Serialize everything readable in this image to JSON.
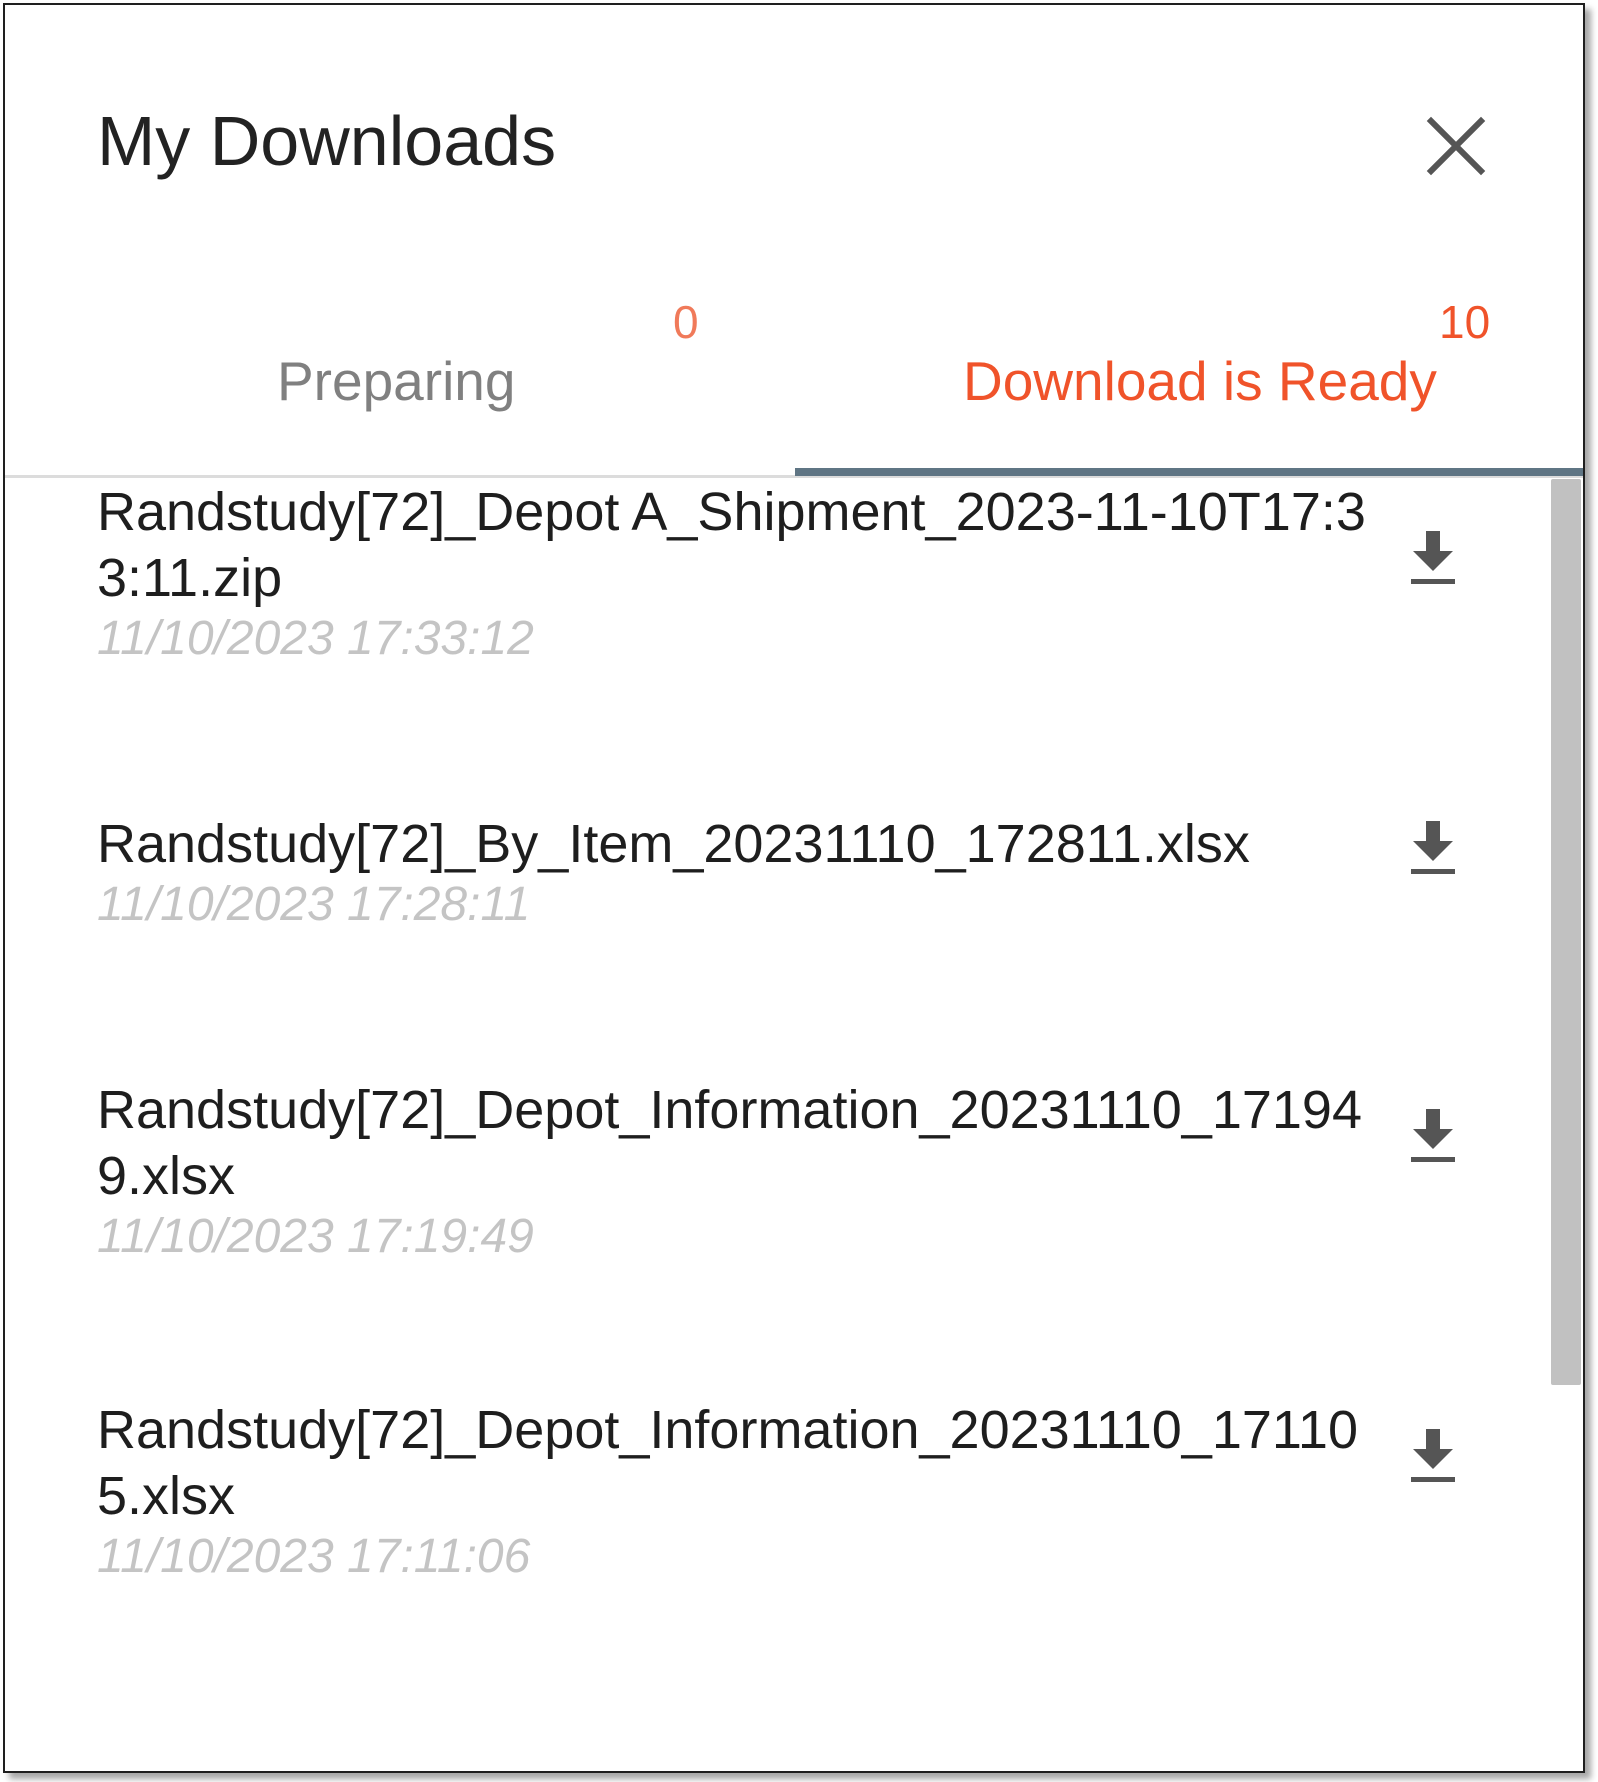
{
  "dialog": {
    "title": "My Downloads",
    "close_icon": "close-icon"
  },
  "tabs": [
    {
      "label": "Preparing",
      "count": "0",
      "active": false
    },
    {
      "label": "Download is Ready",
      "count": "10",
      "active": true
    }
  ],
  "colors": {
    "accent": "#f0532a",
    "indicator": "#5f7584",
    "inactive_tab": "#808080",
    "date_text": "#c4c4c4"
  },
  "downloads": [
    {
      "name": "Randstudy[72]_Depot A_Shipment_2023-11-10T17:33:11.zip",
      "date": "11/10/2023 17:33:12",
      "icon": "download-icon"
    },
    {
      "name": "Randstudy[72]_By_Item_20231110_172811.xlsx",
      "date": "11/10/2023 17:28:11",
      "icon": "download-icon"
    },
    {
      "name": "Randstudy[72]_Depot_Information_20231110_171949.xlsx",
      "date": "11/10/2023 17:19:49",
      "icon": "download-icon"
    },
    {
      "name": "Randstudy[72]_Depot_Information_20231110_171105.xlsx",
      "date": "11/10/2023 17:11:06",
      "icon": "download-icon"
    }
  ]
}
